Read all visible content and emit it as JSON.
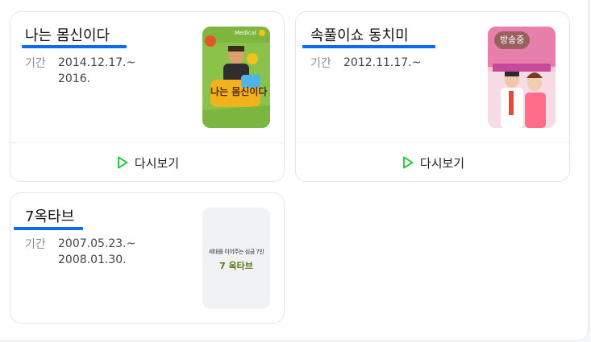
{
  "accent_color": "#0a6cf1",
  "replay_icon_color": "#19c134",
  "programs": [
    {
      "title": "나는 몸신이다",
      "period_label": "기간",
      "period": "2014.12.17.~\n2016.",
      "replay_label": "다시보기",
      "poster_text": "나는 몸신이다",
      "poster_small": "Medical"
    },
    {
      "title": "속풀이쇼 동치미",
      "period_label": "기간",
      "period": "2012.11.17.~",
      "replay_label": "다시보기",
      "badge": "방송중"
    },
    {
      "title": "7옥타브",
      "period_label": "기간",
      "period": "2007.05.23.~\n2008.01.30.",
      "poster_tagline": "세대를 이어주는 심금 7인",
      "poster_title": "7 옥타브"
    }
  ]
}
